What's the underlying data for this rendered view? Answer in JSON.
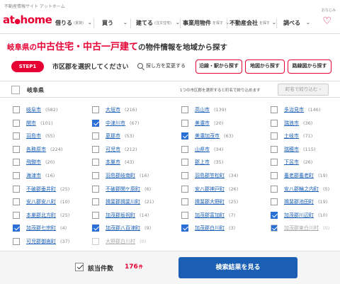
{
  "header": {
    "tagline": "不動産情報サイト アットホーム",
    "logo_at": "at",
    "logo_home": "home",
    "top_right_text": "おなじみ",
    "nav": [
      {
        "label": "借りる",
        "sub": "(賃貸)"
      },
      {
        "label": "買う",
        "sub": ""
      },
      {
        "label": "建てる",
        "sub": "(注文住宅)"
      },
      {
        "label": "事業用物件",
        "sub": "を探す"
      },
      {
        "label": "不動産会社",
        "sub": "を探す"
      },
      {
        "label": "調べる",
        "sub": ""
      }
    ],
    "heart_icon": "heart-icon"
  },
  "page": {
    "title_pref": "岐阜県の",
    "title_type": "中古住宅・中古一戸建て",
    "title_rest": "の物件情報を地域から探す"
  },
  "step": {
    "badge": "STEP1",
    "text": "市区郡を選択してください",
    "howto": "探し方を変更する",
    "buttons": [
      "沿線・駅から探す",
      "地図から探す",
      "路線図から探す"
    ]
  },
  "prefecture": {
    "name": "岐阜県",
    "note": "1つの市区郡を選択すると町名で絞り込めます",
    "narrow_button": "町名で絞り込む",
    "narrow_chevron": "›"
  },
  "cities": [
    [
      {
        "name": "岐阜市",
        "count": "(582)",
        "checked": false,
        "disabled": false
      },
      {
        "name": "大垣市",
        "count": "(216)",
        "checked": false,
        "disabled": false
      },
      {
        "name": "高山市",
        "count": "(139)",
        "checked": false,
        "disabled": false
      },
      {
        "name": "多治見市",
        "count": "(146)",
        "checked": false,
        "disabled": false
      }
    ],
    [
      {
        "name": "関市",
        "count": "(101)",
        "checked": false,
        "disabled": false
      },
      {
        "name": "中津川市",
        "count": "(67)",
        "checked": true,
        "disabled": false
      },
      {
        "name": "美濃市",
        "count": "(20)",
        "checked": false,
        "disabled": false
      },
      {
        "name": "瑞浪市",
        "count": "(36)",
        "checked": false,
        "disabled": false
      }
    ],
    [
      {
        "name": "羽島市",
        "count": "(55)",
        "checked": false,
        "disabled": false
      },
      {
        "name": "恵那市",
        "count": "(53)",
        "checked": false,
        "disabled": false
      },
      {
        "name": "美濃加茂市",
        "count": "(63)",
        "checked": true,
        "disabled": false
      },
      {
        "name": "土岐市",
        "count": "(71)",
        "checked": false,
        "disabled": false
      }
    ],
    [
      {
        "name": "各務原市",
        "count": "(224)",
        "checked": false,
        "disabled": false
      },
      {
        "name": "可児市",
        "count": "(212)",
        "checked": false,
        "disabled": false
      },
      {
        "name": "山県市",
        "count": "(34)",
        "checked": false,
        "disabled": false
      },
      {
        "name": "瑞穂市",
        "count": "(115)",
        "checked": false,
        "disabled": false
      }
    ],
    [
      {
        "name": "飛騨市",
        "count": "(20)",
        "checked": false,
        "disabled": false
      },
      {
        "name": "本巣市",
        "count": "(43)",
        "checked": false,
        "disabled": false
      },
      {
        "name": "郡上市",
        "count": "(35)",
        "checked": false,
        "disabled": false
      },
      {
        "name": "下呂市",
        "count": "(26)",
        "checked": false,
        "disabled": false
      }
    ],
    [
      {
        "name": "海津市",
        "count": "(16)",
        "checked": false,
        "disabled": false
      },
      {
        "name": "羽島郡岐南町",
        "count": "(16)",
        "checked": false,
        "disabled": false
      },
      {
        "name": "羽島郡笠松町",
        "count": "(34)",
        "checked": false,
        "disabled": false
      },
      {
        "name": "養老郡養老町",
        "count": "(19)",
        "checked": false,
        "disabled": false
      }
    ],
    [
      {
        "name": "不破郡垂井町",
        "count": "(25)",
        "checked": false,
        "disabled": false
      },
      {
        "name": "不破郡関ケ原町",
        "count": "(6)",
        "checked": false,
        "disabled": false
      },
      {
        "name": "安八郡神戸町",
        "count": "(26)",
        "checked": false,
        "disabled": false
      },
      {
        "name": "安八郡輪之内町",
        "count": "(5)",
        "checked": false,
        "disabled": false
      }
    ],
    [
      {
        "name": "安八郡安八町",
        "count": "(10)",
        "checked": false,
        "disabled": false
      },
      {
        "name": "揖斐郡揖斐川町",
        "count": "(21)",
        "checked": false,
        "disabled": false
      },
      {
        "name": "揖斐郡大野町",
        "count": "(25)",
        "checked": false,
        "disabled": false
      },
      {
        "name": "揖斐郡池田町",
        "count": "(19)",
        "checked": false,
        "disabled": false
      }
    ],
    [
      {
        "name": "本巣郡北方町",
        "count": "(25)",
        "checked": false,
        "disabled": false
      },
      {
        "name": "加茂郡坂祝町",
        "count": "(14)",
        "checked": false,
        "disabled": false
      },
      {
        "name": "加茂郡富加町",
        "count": "(7)",
        "checked": false,
        "disabled": false
      },
      {
        "name": "加茂郡川辺町",
        "count": "(10)",
        "checked": true,
        "disabled": false
      }
    ],
    [
      {
        "name": "加茂郡七宗町",
        "count": "(4)",
        "checked": true,
        "disabled": false
      },
      {
        "name": "加茂郡八百津町",
        "count": "(9)",
        "checked": true,
        "disabled": false
      },
      {
        "name": "加茂郡白川町",
        "count": "(3)",
        "checked": true,
        "disabled": false
      },
      {
        "name": "加茂郡東白川村",
        "count": "(0)",
        "checked": true,
        "disabled": true
      }
    ],
    [
      {
        "name": "可児郡御嵩町",
        "count": "(37)",
        "checked": false,
        "disabled": false
      },
      {
        "name": "大野郡白川村",
        "count": "(0)",
        "checked": false,
        "disabled": true
      }
    ]
  ],
  "footer": {
    "label": "該当件数",
    "count": "176",
    "unit": "件",
    "search_button": "検索結果を見る"
  }
}
